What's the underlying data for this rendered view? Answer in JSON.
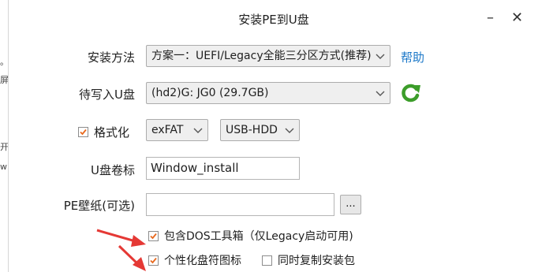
{
  "background": {
    "fragments": [
      "。",
      "屏",
      "开",
      "w"
    ]
  },
  "window": {
    "title": "安装PE到U盘",
    "minimize_glyph": "–",
    "close_glyph": "✕"
  },
  "form": {
    "method": {
      "label": "安装方法",
      "value": "方案一：UEFI/Legacy全能三分区方式(推荐)",
      "help": "帮助"
    },
    "disk": {
      "label": "待写入U盘",
      "value": "(hd2)G: JG0 (29.7GB)"
    },
    "format": {
      "label": "格式化",
      "checked": true,
      "fs": "exFAT",
      "mode": "USB-HDD"
    },
    "volume": {
      "label": "U盘卷标",
      "value": "Window_install"
    },
    "wallpaper": {
      "label": "PE壁纸(可选)",
      "value": "",
      "browse": "..."
    },
    "dos_toolbox": {
      "label": "包含DOS工具箱（仅Legacy启动可用)",
      "checked": true
    },
    "custom_icon": {
      "label": "个性化盘符图标",
      "checked": true
    },
    "copy_installer": {
      "label": "同时复制安装包",
      "checked": false
    }
  },
  "colors": {
    "accent_link": "#1c78c8",
    "check": "#e8691e",
    "arrow": "#e53935",
    "refresh": "#3c9d2a"
  },
  "icons": {
    "refresh": "refresh-icon",
    "caret": "chevron-down-icon",
    "check": "check-icon",
    "arrow": "red-arrow-annotation"
  }
}
